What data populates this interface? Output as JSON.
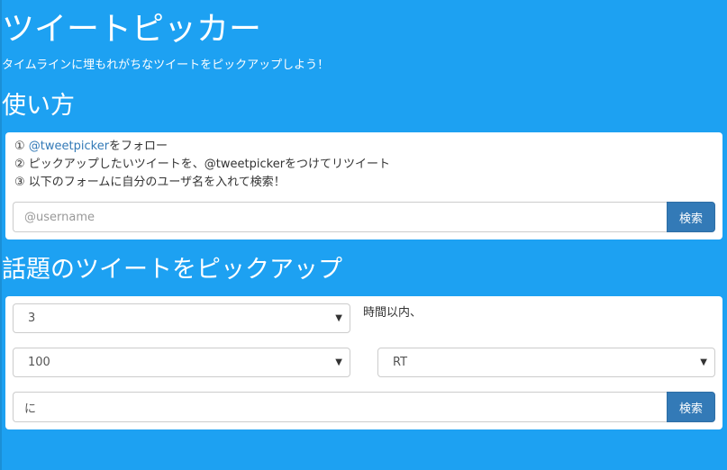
{
  "header": {
    "title": "ツイートピッカー",
    "subtitle": "タイムラインに埋もれがちなツイートをピックアップしよう！"
  },
  "howto": {
    "title": "使い方",
    "steps": [
      {
        "marker": "①",
        "link": "@tweetpicker",
        "text": "をフォロー"
      },
      {
        "marker": "②",
        "text": "ピックアップしたいツイートを、@tweetpickerをつけてリツイート"
      },
      {
        "marker": "③",
        "text": "以下のフォームに自分のユーザ名を入れて検索！"
      }
    ],
    "search": {
      "placeholder": "@username",
      "value": "",
      "button_label": "検索"
    }
  },
  "trending": {
    "title": "話題のツイートをピックアップ",
    "hours_select": {
      "value": "3"
    },
    "hours_suffix": "時間以内、",
    "count_select": {
      "value": "100"
    },
    "type_select": {
      "value": "RT"
    },
    "search": {
      "value": "に",
      "placeholder": "",
      "button_label": "検索"
    }
  },
  "icons": {
    "select_caret": "▼"
  },
  "colors": {
    "background": "#1da1f2",
    "button": "#337ab7",
    "link": "#337ab7"
  }
}
